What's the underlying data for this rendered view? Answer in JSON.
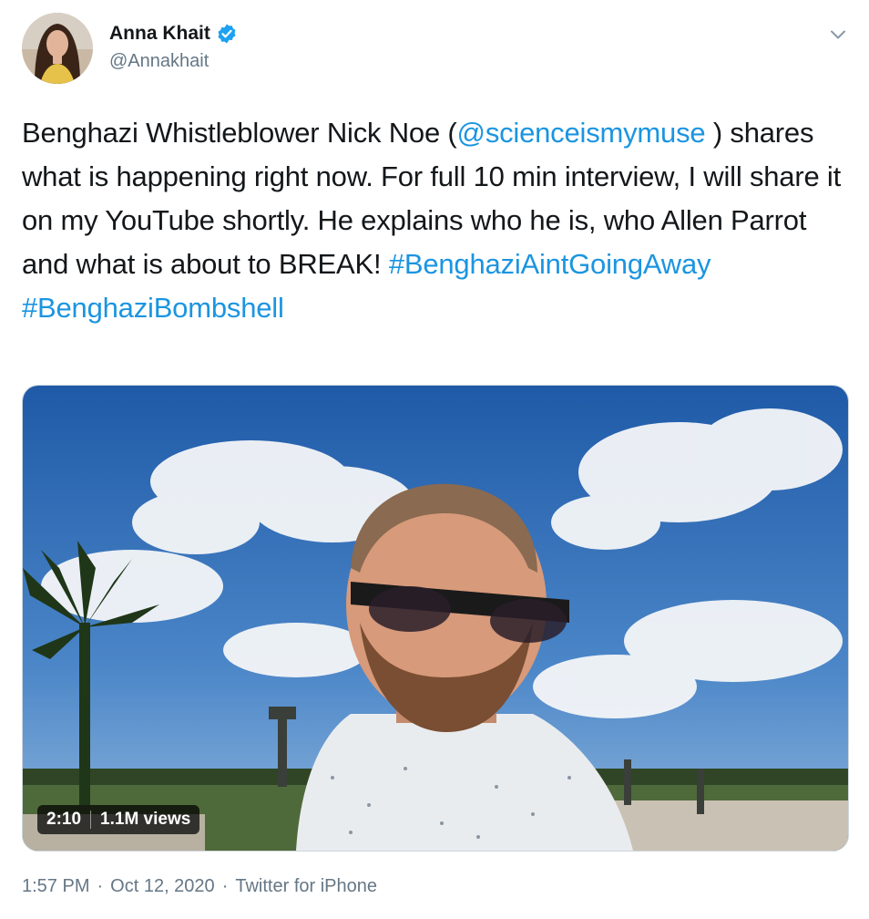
{
  "author": {
    "display_name": "Anna Khait",
    "handle": "@Annakhait",
    "verified": true,
    "verified_icon": "verified-badge-icon",
    "avatar_icon": "avatar"
  },
  "menu": {
    "icon": "chevron-down-icon"
  },
  "tweet": {
    "segments": [
      {
        "text": "Benghazi Whistleblower Nick Noe (",
        "type": "text"
      },
      {
        "text": "@scienceismymuse",
        "type": "mention"
      },
      {
        "text": " ) shares what is happening right now. For full 10 min interview, I will share it on my YouTube shortly. He explains who he is, who Allen Parrot and what is about to BREAK! ",
        "type": "text"
      },
      {
        "text": "#BenghaziAintGoingAway",
        "type": "hashtag"
      },
      {
        "text": " ",
        "type": "text"
      },
      {
        "text": "#BenghaziBombshell",
        "type": "hashtag"
      }
    ]
  },
  "media": {
    "duration": "2:10",
    "views": "1.1M views"
  },
  "footer": {
    "time": "1:57 PM",
    "separator": "·",
    "date": "Oct 12, 2020",
    "source": "Twitter for iPhone"
  },
  "colors": {
    "link": "#1b95e0",
    "text": "#14171a",
    "secondary": "#657786",
    "verified": "#1da1f2"
  }
}
